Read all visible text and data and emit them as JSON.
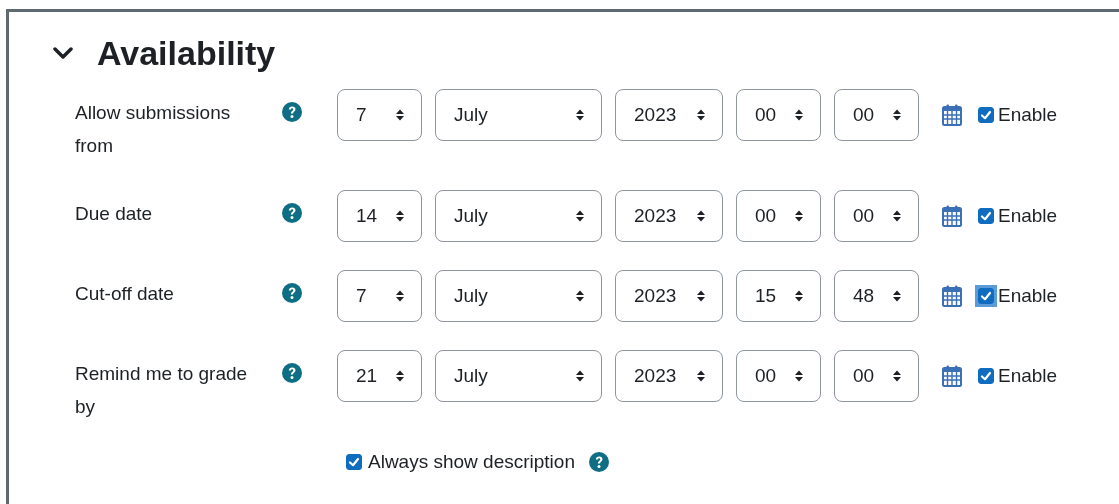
{
  "section": {
    "title": "Availability",
    "expanded": true
  },
  "rows": [
    {
      "label": "Allow submissions from",
      "day": "7",
      "month": "July",
      "year": "2023",
      "hour": "00",
      "minute": "00",
      "enabled": true,
      "focused": false,
      "enable_label": "Enable"
    },
    {
      "label": "Due date",
      "day": "14",
      "month": "July",
      "year": "2023",
      "hour": "00",
      "minute": "00",
      "enabled": true,
      "focused": false,
      "enable_label": "Enable"
    },
    {
      "label": "Cut-off date",
      "day": "7",
      "month": "July",
      "year": "2023",
      "hour": "15",
      "minute": "48",
      "enabled": true,
      "focused": true,
      "enable_label": "Enable"
    },
    {
      "label": "Remind me to grade by",
      "day": "21",
      "month": "July",
      "year": "2023",
      "hour": "00",
      "minute": "00",
      "enabled": true,
      "focused": false,
      "enable_label": "Enable"
    }
  ],
  "always_show_description": {
    "label": "Always show description",
    "checked": true
  }
}
